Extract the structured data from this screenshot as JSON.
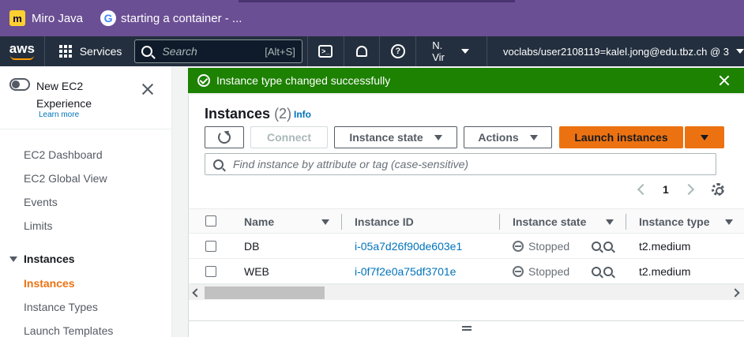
{
  "browser": {
    "bookmarks": [
      {
        "label": "Miro Java",
        "icon": "miro-logo"
      },
      {
        "label": "starting a container - ...",
        "icon": "google-logo"
      }
    ]
  },
  "awsnav": {
    "logo": "aws",
    "services_label": "Services",
    "search_placeholder": "Search",
    "search_shortcut": "[Alt+S]",
    "region": "N. Vir",
    "account": "voclabs/user2108119=kalel.jong@edu.tbz.ch @ 3"
  },
  "sidebar": {
    "title": "New EC2 Experience",
    "learn_more": "Learn more",
    "links": [
      "EC2 Dashboard",
      "EC2 Global View",
      "Events",
      "Limits"
    ],
    "section": "Instances",
    "section_items": [
      {
        "label": "Instances",
        "active": true
      },
      {
        "label": "Instance Types",
        "active": false
      },
      {
        "label": "Launch Templates",
        "active": false
      }
    ]
  },
  "flash": {
    "message": "Instance type changed successfully",
    "color": "#1d8102"
  },
  "panel": {
    "title": "Instances",
    "count": "(2)",
    "info": "Info",
    "buttons": {
      "connect": "Connect",
      "instance_state": "Instance state",
      "actions": "Actions",
      "launch": "Launch instances"
    },
    "filter_placeholder": "Find instance by attribute or tag (case-sensitive)",
    "page": "1",
    "accent": "#ec7211"
  },
  "table": {
    "columns": [
      "Name",
      "Instance ID",
      "Instance state",
      "Instance type"
    ],
    "rows": [
      {
        "name": "DB",
        "id": "i-05a7d26f90de603e1",
        "state": "Stopped",
        "type": "t2.medium"
      },
      {
        "name": "WEB",
        "id": "i-0f7f2e0a75df3701e",
        "state": "Stopped",
        "type": "t2.medium"
      }
    ]
  }
}
